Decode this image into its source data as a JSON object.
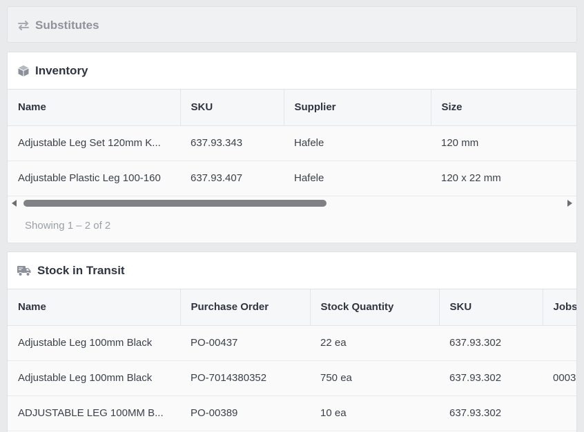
{
  "substitutes": {
    "title": "Substitutes",
    "icon": "swap-arrows-icon"
  },
  "inventory": {
    "title": "Inventory",
    "icon": "cube-icon",
    "columns": [
      "Name",
      "SKU",
      "Supplier",
      "Size"
    ],
    "rows": [
      [
        "Adjustable Leg Set 120mm K...",
        "637.93.343",
        "Hafele",
        "120 mm"
      ],
      [
        "Adjustable Plastic Leg 100-160",
        "637.93.407",
        "Hafele",
        "120 x 22 mm"
      ]
    ],
    "footer": "Showing 1 – 2 of 2",
    "scroll_position": 0
  },
  "transit": {
    "title": "Stock in Transit",
    "icon": "truck-icon",
    "columns": [
      "Name",
      "Purchase Order",
      "Stock Quantity",
      "SKU",
      "Jobs"
    ],
    "rows": [
      [
        "Adjustable Leg 100mm Black",
        "PO-00437",
        "22 ea",
        "637.93.302",
        ""
      ],
      [
        "Adjustable Leg 100mm Black",
        "PO-7014380352",
        "750 ea",
        "637.93.302",
        "0003"
      ],
      [
        "ADJUSTABLE LEG 100MM B...",
        "PO-00389",
        "10 ea",
        "637.93.302",
        ""
      ]
    ]
  }
}
